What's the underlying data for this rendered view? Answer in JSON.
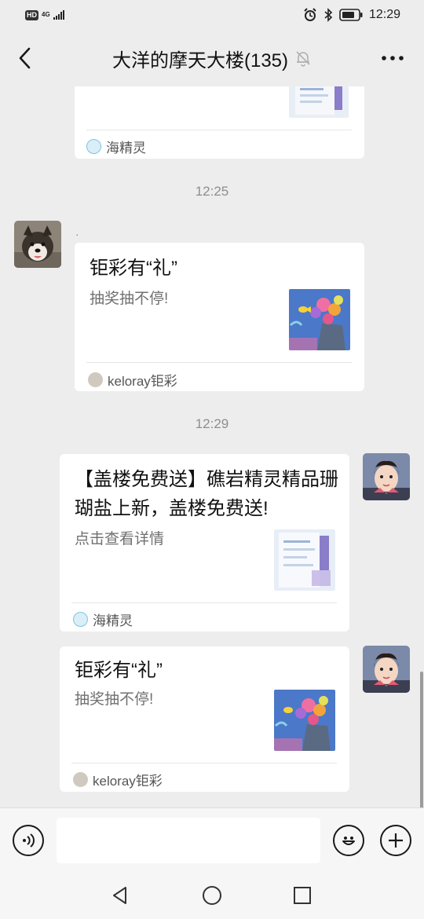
{
  "status_bar": {
    "hd": "HD",
    "network": "4G",
    "time": "12:29"
  },
  "header": {
    "title": "大洋的摩天大楼(135)",
    "back_icon": "chevron-left-icon",
    "mute_icon": "bell-off-icon",
    "more_icon": "more-dots-icon"
  },
  "messages": {
    "card1": {
      "source": "海精灵"
    },
    "time1": "12:25",
    "msg2": {
      "sender_name": "·",
      "title": "钜彩有“礼”",
      "desc": "抽奖抽不停!",
      "source": "keloray钜彩"
    },
    "time2": "12:29",
    "msg3": {
      "title": "【盖楼免费送】礁岩精灵精品珊瑚盐上新，盖楼免费送!",
      "desc": "点击查看详情",
      "source": "海精灵"
    },
    "msg4": {
      "title": "钜彩有“礼”",
      "desc": "抽奖抽不停!",
      "source": "keloray钜彩"
    }
  },
  "input_bar": {
    "voice_icon": "voice-icon",
    "emoji_icon": "emoji-icon",
    "plus_icon": "plus-icon",
    "input_value": ""
  },
  "nav": {
    "back_icon": "nav-back-icon",
    "home_icon": "nav-home-icon",
    "recent_icon": "nav-recent-icon"
  },
  "colors": {
    "background": "#ededed",
    "bubble": "#ffffff",
    "time_text": "#8e8e8e",
    "desc_text": "#707070"
  }
}
